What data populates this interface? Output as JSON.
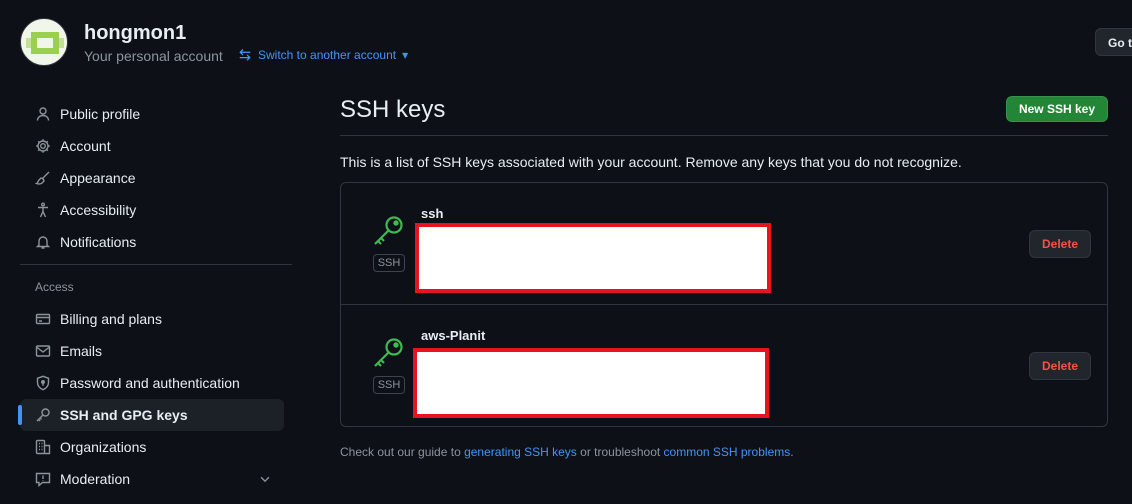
{
  "header": {
    "username": "hongmon1",
    "subtitle": "Your personal account",
    "switch_label": "Switch to another account",
    "goto_label": "Go to your personal profile"
  },
  "sidebar": {
    "items": [
      {
        "label": "Public profile",
        "icon": "person-icon"
      },
      {
        "label": "Account",
        "icon": "gear-icon"
      },
      {
        "label": "Appearance",
        "icon": "paintbrush-icon"
      },
      {
        "label": "Accessibility",
        "icon": "accessibility-icon"
      },
      {
        "label": "Notifications",
        "icon": "bell-icon"
      }
    ],
    "access_heading": "Access",
    "access_items": [
      {
        "label": "Billing and plans",
        "icon": "credit-card-icon"
      },
      {
        "label": "Emails",
        "icon": "mail-icon"
      },
      {
        "label": "Password and authentication",
        "icon": "shield-lock-icon"
      },
      {
        "label": "SSH and GPG keys",
        "icon": "key-icon",
        "active": true
      },
      {
        "label": "Organizations",
        "icon": "organization-icon"
      },
      {
        "label": "Moderation",
        "icon": "report-icon"
      }
    ]
  },
  "main": {
    "title": "SSH keys",
    "new_button": "New SSH key",
    "description": "This is a list of SSH keys associated with your account. Remove any keys that you do not recognize.",
    "keys": [
      {
        "name": "ssh",
        "badge": "SSH",
        "delete_label": "Delete"
      },
      {
        "name": "aws-Planit",
        "badge": "SSH",
        "delete_label": "Delete"
      }
    ],
    "guide": {
      "prefix": "Check out our guide to ",
      "link1": "generating SSH keys",
      "middle": " or troubleshoot ",
      "link2": "common SSH problems",
      "suffix": "."
    }
  },
  "colors": {
    "background": "#0d1117",
    "accent_blue": "#4493f8",
    "button_green": "#238636",
    "key_icon_green": "#3fb950",
    "danger_red": "#f85149",
    "redaction_border": "#e8131f"
  }
}
